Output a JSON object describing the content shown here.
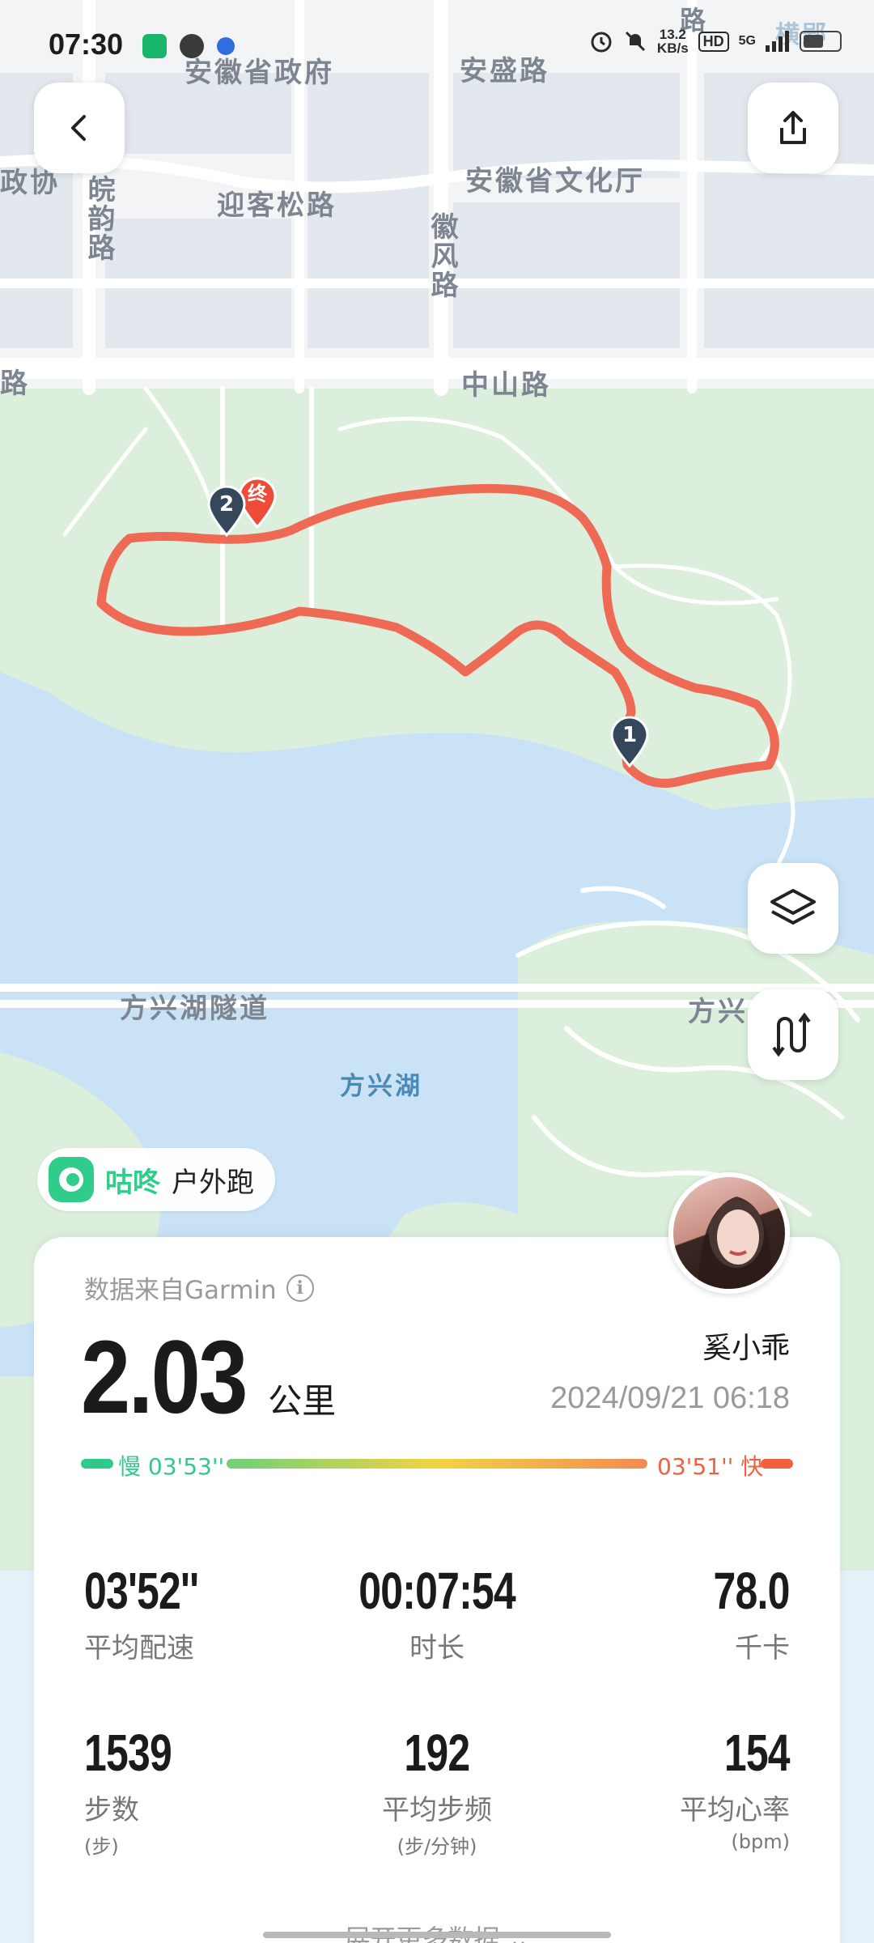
{
  "status_bar": {
    "time": "07:30",
    "speed_value": "13.2",
    "speed_unit": "KB/s",
    "hd_badge": "HD",
    "network": "5G",
    "icons": [
      "app-green-icon",
      "app-leaf-icon",
      "baidu-paw-icon",
      "alarm-icon",
      "mute-icon",
      "signal-icon",
      "battery-icon"
    ]
  },
  "map": {
    "labels": {
      "road_top": "路",
      "anhui_gov": "安徽省政府",
      "ansheng": "安盛路",
      "zhengxie": "政协",
      "culture": "安徽省文化厅",
      "wanyun": "皖韵路",
      "yingkesong": "迎客松路",
      "huifeng": "徽风路",
      "road_left": "路",
      "zhongshan": "中山路",
      "fangxing_tunnel": "方兴湖隧道",
      "fangxing_right": "方兴",
      "fangxing_lake": "方兴湖",
      "hengying": "横郢"
    },
    "route_color": "#ee6a55",
    "end_marker": "终",
    "lap_markers": [
      "1",
      "2"
    ]
  },
  "buttons": {
    "back": "chevron-left-icon",
    "share": "share-icon",
    "layers": "layers-icon",
    "elevation": "route-wave-icon"
  },
  "source_tag": {
    "app_name": "咕咚",
    "activity": "户外跑"
  },
  "card": {
    "data_source": "数据来自Garmin",
    "distance_value": "2.03",
    "distance_unit": "公里",
    "user_name": "奚小乖",
    "datetime": "2024/09/21 06:18",
    "pace_slow": "慢 03'53''",
    "pace_fast": "03'51'' 快",
    "stats": [
      {
        "value": "03'52''",
        "label": "平均配速",
        "unit": ""
      },
      {
        "value": "00:07:54",
        "label": "时长",
        "unit": ""
      },
      {
        "value": "78.0",
        "label": "千卡",
        "unit": ""
      },
      {
        "value": "1539",
        "label": "步数",
        "unit": "(步)"
      },
      {
        "value": "192",
        "label": "平均步频",
        "unit": "(步/分钟)"
      },
      {
        "value": "154",
        "label": "平均心率",
        "unit": "(bpm)"
      }
    ],
    "expand": "展开更多数据 ⌄"
  },
  "colors": {
    "accent_green": "#2fcc8b",
    "slow": "#30c98c",
    "fast": "#f0613f",
    "lake": "#c9e2f5",
    "park": "#dcefdc"
  }
}
